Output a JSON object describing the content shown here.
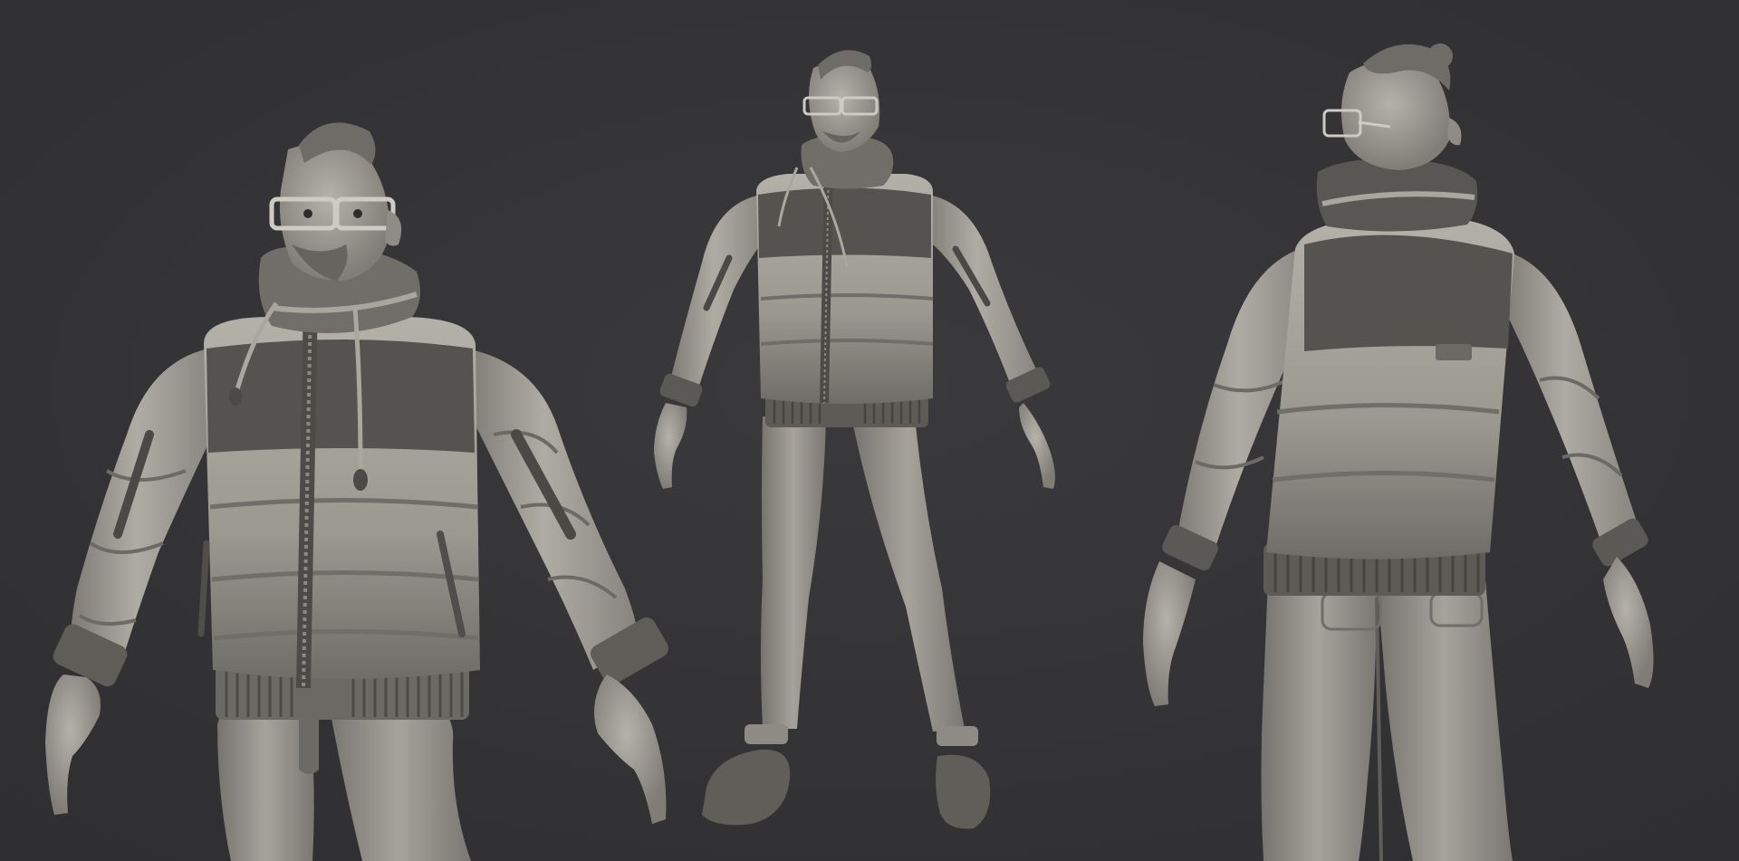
{
  "scene": {
    "background_color": "#333335",
    "views": [
      {
        "id": "three-quarter-front-closeup"
      },
      {
        "id": "front-full-body"
      },
      {
        "id": "back-three-quarter"
      }
    ]
  },
  "palette": {
    "clay_light": "#a7a59c",
    "clay_mid": "#8f8d85",
    "clay_dark": "#5d5c57",
    "clay_shadow": "#3f3f3d",
    "yoke": "#555552",
    "highlight": "#c4c2b9"
  }
}
